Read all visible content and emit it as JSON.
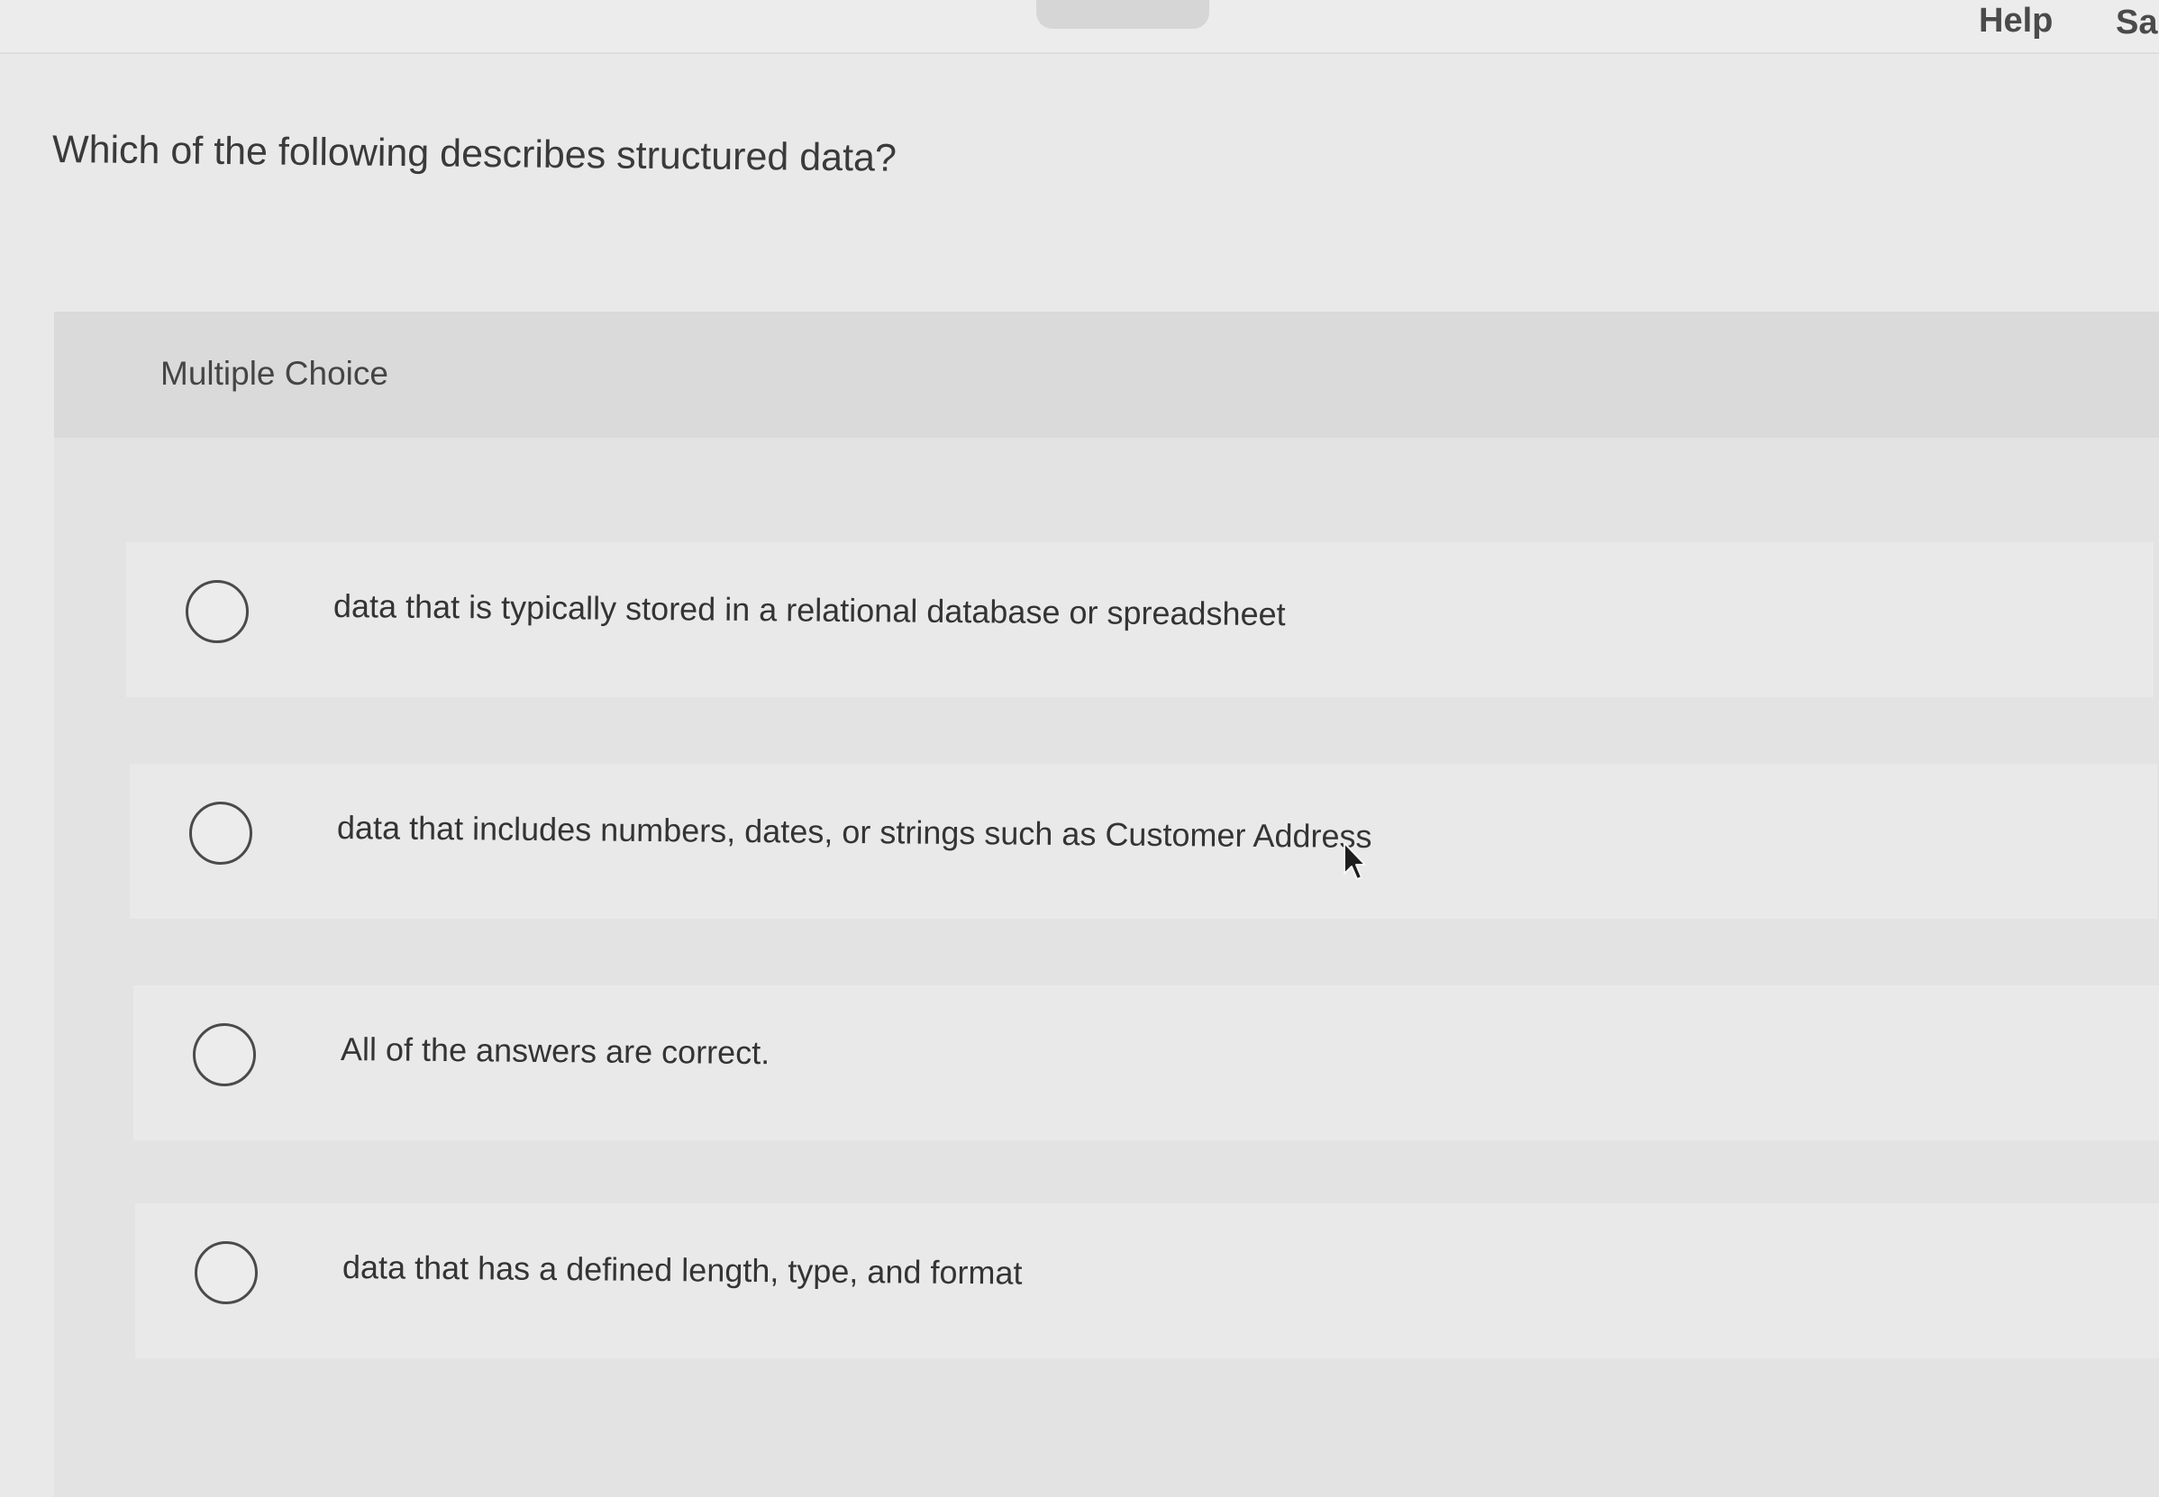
{
  "header": {
    "help_label": "Help",
    "save_label": "Sa"
  },
  "question": {
    "text": "Which of the following describes structured data?"
  },
  "card": {
    "type_label": "Multiple Choice",
    "choices": [
      {
        "label": "data that is typically stored in a relational database or spreadsheet"
      },
      {
        "label": "data that includes numbers, dates, or strings such as Customer Address"
      },
      {
        "label": "All of the answers are correct."
      },
      {
        "label": "data that has a defined length, type, and format"
      }
    ]
  }
}
